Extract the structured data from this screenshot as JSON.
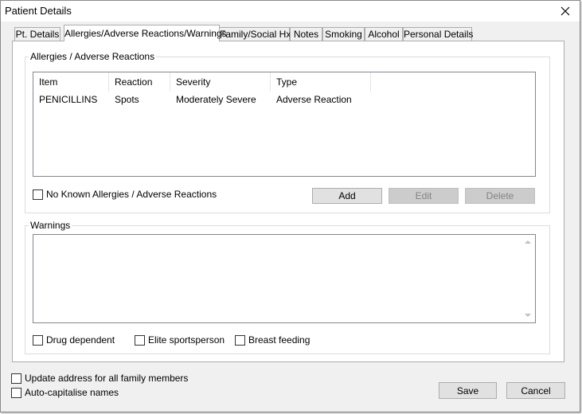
{
  "window": {
    "title": "Patient Details",
    "close_icon": "close-icon"
  },
  "tabs": [
    {
      "label": "Pt. Details"
    },
    {
      "label": "Allergies/Adverse Reactions/Warnings",
      "active": true
    },
    {
      "label": "Family/Social Hx"
    },
    {
      "label": "Notes"
    },
    {
      "label": "Smoking"
    },
    {
      "label": "Alcohol"
    },
    {
      "label": "Personal Details"
    }
  ],
  "allergies": {
    "group_label": "Allergies / Adverse Reactions",
    "columns": [
      "Item",
      "Reaction",
      "Severity",
      "Type"
    ],
    "rows": [
      [
        "PENICILLINS",
        "Spots",
        "Moderately Severe",
        "Adverse Reaction"
      ]
    ],
    "no_known_label": "No Known Allergies / Adverse Reactions",
    "no_known_checked": false,
    "add_label": "Add",
    "edit_label": "Edit",
    "delete_label": "Delete"
  },
  "warnings": {
    "group_label": "Warnings",
    "text": "",
    "drug_dependent_label": "Drug dependent",
    "elite_sportsperson_label": "Elite sportsperson",
    "breast_feeding_label": "Breast feeding"
  },
  "footer": {
    "update_address_label": "Update address for all family members",
    "auto_capitalise_label": "Auto-capitalise names",
    "save_label": "Save",
    "cancel_label": "Cancel"
  }
}
